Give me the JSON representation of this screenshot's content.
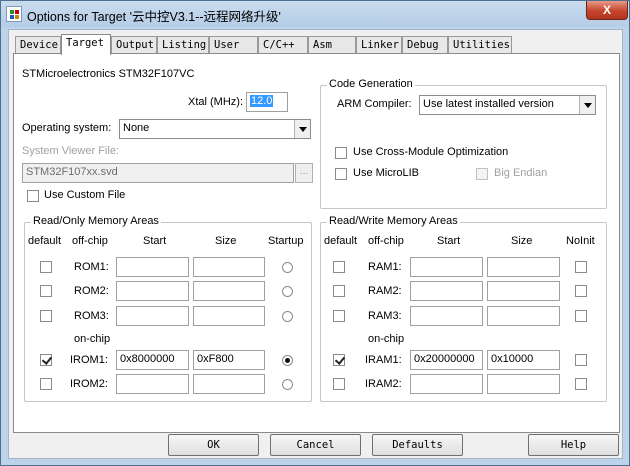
{
  "window": {
    "title": "Options for Target '云中控V3.1--远程网络升级'",
    "close_label": "X"
  },
  "tabs": [
    "Device",
    "Target",
    "Output",
    "Listing",
    "User",
    "C/C++",
    "Asm",
    "Linker",
    "Debug",
    "Utilities"
  ],
  "device": {
    "name": "STMicroelectronics STM32F107VC"
  },
  "xtal": {
    "label": "Xtal (MHz):",
    "value": "12.0"
  },
  "os": {
    "label": "Operating system:",
    "value": "None"
  },
  "svd": {
    "label": "System Viewer File:",
    "value": "STM32F107xx.svd",
    "browse": "...",
    "custom_label": "Use Custom File"
  },
  "codegen": {
    "title": "Code Generation",
    "arm_label": "ARM Compiler:",
    "arm_value": "Use latest installed version",
    "cross_module": "Use Cross-Module Optimization",
    "microlib": "Use MicroLIB",
    "big_endian": "Big Endian"
  },
  "rom": {
    "title": "Read/Only Memory Areas",
    "headers": {
      "default": "default",
      "offchip": "off-chip",
      "start": "Start",
      "size": "Size",
      "startup": "Startup"
    },
    "onchip_label": "on-chip",
    "rows": [
      {
        "label": "ROM1:",
        "start": "",
        "size": ""
      },
      {
        "label": "ROM2:",
        "start": "",
        "size": ""
      },
      {
        "label": "ROM3:",
        "start": "",
        "size": ""
      },
      {
        "label": "IROM1:",
        "start": "0x8000000",
        "size": "0xF800"
      },
      {
        "label": "IROM2:",
        "start": "",
        "size": ""
      }
    ]
  },
  "ram": {
    "title": "Read/Write Memory Areas",
    "headers": {
      "default": "default",
      "offchip": "off-chip",
      "start": "Start",
      "size": "Size",
      "noinit": "NoInit"
    },
    "onchip_label": "on-chip",
    "rows": [
      {
        "label": "RAM1:",
        "start": "",
        "size": ""
      },
      {
        "label": "RAM2:",
        "start": "",
        "size": ""
      },
      {
        "label": "RAM3:",
        "start": "",
        "size": ""
      },
      {
        "label": "IRAM1:",
        "start": "0x20000000",
        "size": "0x10000"
      },
      {
        "label": "IRAM2:",
        "start": "",
        "size": ""
      }
    ]
  },
  "buttons": {
    "ok": "OK",
    "cancel": "Cancel",
    "defaults": "Defaults",
    "help": "Help"
  }
}
